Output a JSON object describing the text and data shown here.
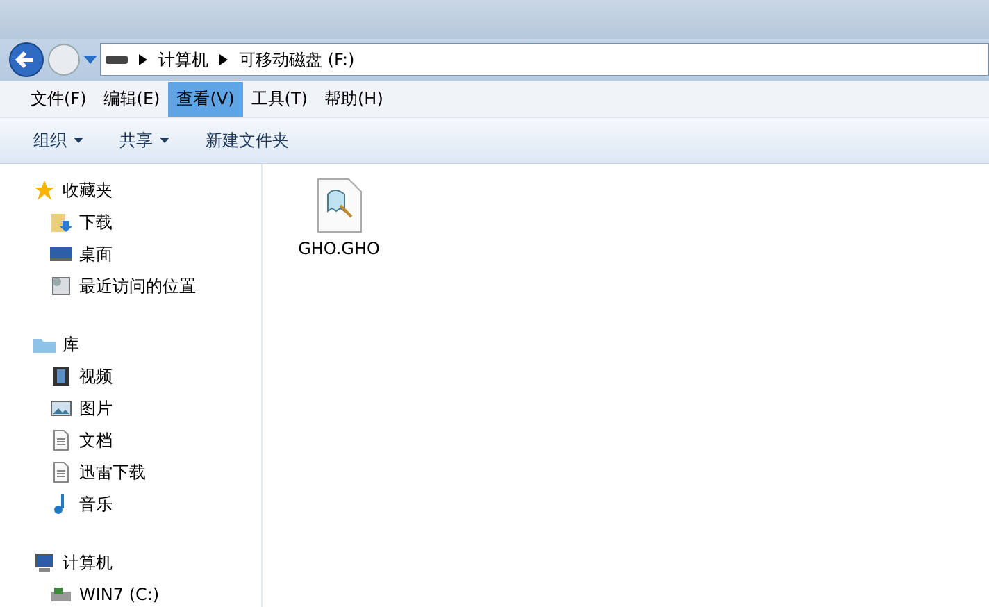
{
  "address": {
    "path": [
      "计算机",
      "可移动磁盘 (F:)"
    ]
  },
  "menu": [
    {
      "label": "文件(F)",
      "selected": false
    },
    {
      "label": "编辑(E)",
      "selected": false
    },
    {
      "label": "查看(V)",
      "selected": true
    },
    {
      "label": "工具(T)",
      "selected": false
    },
    {
      "label": "帮助(H)",
      "selected": false
    }
  ],
  "toolbar": [
    {
      "label": "组织",
      "dropdown": true
    },
    {
      "label": "共享",
      "dropdown": true
    },
    {
      "label": "新建文件夹",
      "dropdown": false
    }
  ],
  "sidebar": [
    {
      "label": "收藏夹",
      "kind": "star",
      "children": [
        {
          "label": "下载",
          "kind": "download"
        },
        {
          "label": "桌面",
          "kind": "desktop"
        },
        {
          "label": "最近访问的位置",
          "kind": "recent"
        }
      ]
    },
    {
      "label": "库",
      "kind": "library",
      "children": [
        {
          "label": "视频",
          "kind": "video"
        },
        {
          "label": "图片",
          "kind": "picture"
        },
        {
          "label": "文档",
          "kind": "document"
        },
        {
          "label": "迅雷下载",
          "kind": "document"
        },
        {
          "label": "音乐",
          "kind": "music"
        }
      ]
    },
    {
      "label": "计算机",
      "kind": "computer",
      "children": [
        {
          "label": "WIN7 (C:)",
          "kind": "drive"
        }
      ]
    }
  ],
  "files": [
    {
      "name": "GHO.GHO"
    }
  ]
}
